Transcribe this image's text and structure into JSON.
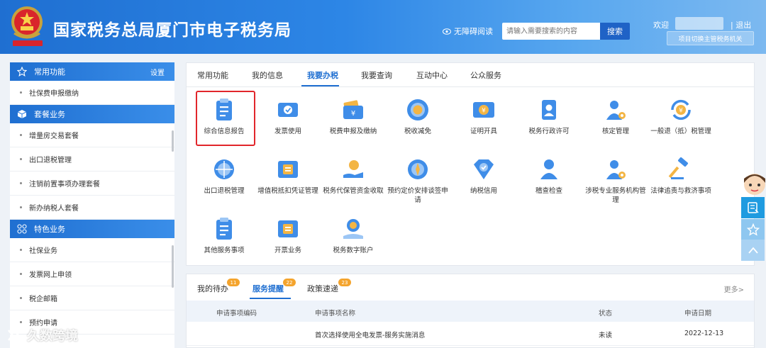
{
  "header": {
    "title": "国家税务总局厦门市电子税务局",
    "accessibility": "无障碍阅读",
    "search_placeholder": "请输入需要搜索的内容",
    "search_button": "搜索",
    "welcome": "欢迎",
    "logout": "| 退出",
    "switch_org": "项目切换主管税务机关",
    "emblem_text": "中国税务"
  },
  "sidebar": {
    "sections": [
      {
        "title": "常用功能",
        "icon": "star-icon",
        "action": "设置",
        "items": [
          "社保费申报缴纳"
        ]
      },
      {
        "title": "套餐业务",
        "icon": "cube-icon",
        "items": [
          "增量房交易套餐",
          "出口退税管理",
          "注销前置事项办理套餐",
          "新办纳税人套餐"
        ]
      },
      {
        "title": "特色业务",
        "icon": "grid-icon",
        "items": [
          "社保业务",
          "发票网上申领",
          "税企邮箱",
          "预约申请"
        ]
      }
    ]
  },
  "tabs": [
    "常用功能",
    "我的信息",
    "我要办税",
    "我要查询",
    "互动中心",
    "公众服务"
  ],
  "active_tab": "我要办税",
  "services": [
    "综合信息报告",
    "发票使用",
    "税费申报及缴纳",
    "税收减免",
    "证明开具",
    "税务行政许可",
    "核定管理",
    "一般退（抵）税管理",
    "出口退税管理",
    "增值税抵扣凭证管理",
    "税务代保管资金收取",
    "预约定价安排谈签申请",
    "纳税信用",
    "稽查检查",
    "涉税专业服务机构管理",
    "法律追责与救济事项",
    "其他服务事项",
    "开票业务",
    "税务数字账户"
  ],
  "bottom": {
    "tabs": [
      {
        "label": "我的待办",
        "count": "11"
      },
      {
        "label": "服务提醒",
        "count": "22"
      },
      {
        "label": "政策速递",
        "count": "23"
      }
    ],
    "more": "更多>",
    "columns": [
      "申请事项编码",
      "申请事项名称",
      "状态",
      "申请日期"
    ],
    "rows": [
      {
        "code": "",
        "name": "首次选择使用全电发票-服务实施消息",
        "status": "未读",
        "date": "2022-12-13"
      }
    ]
  },
  "watermark": "久数跨境",
  "colors": {
    "primary": "#1f6fd1",
    "highlight": "#e1262b",
    "badge": "#f4a42d"
  }
}
